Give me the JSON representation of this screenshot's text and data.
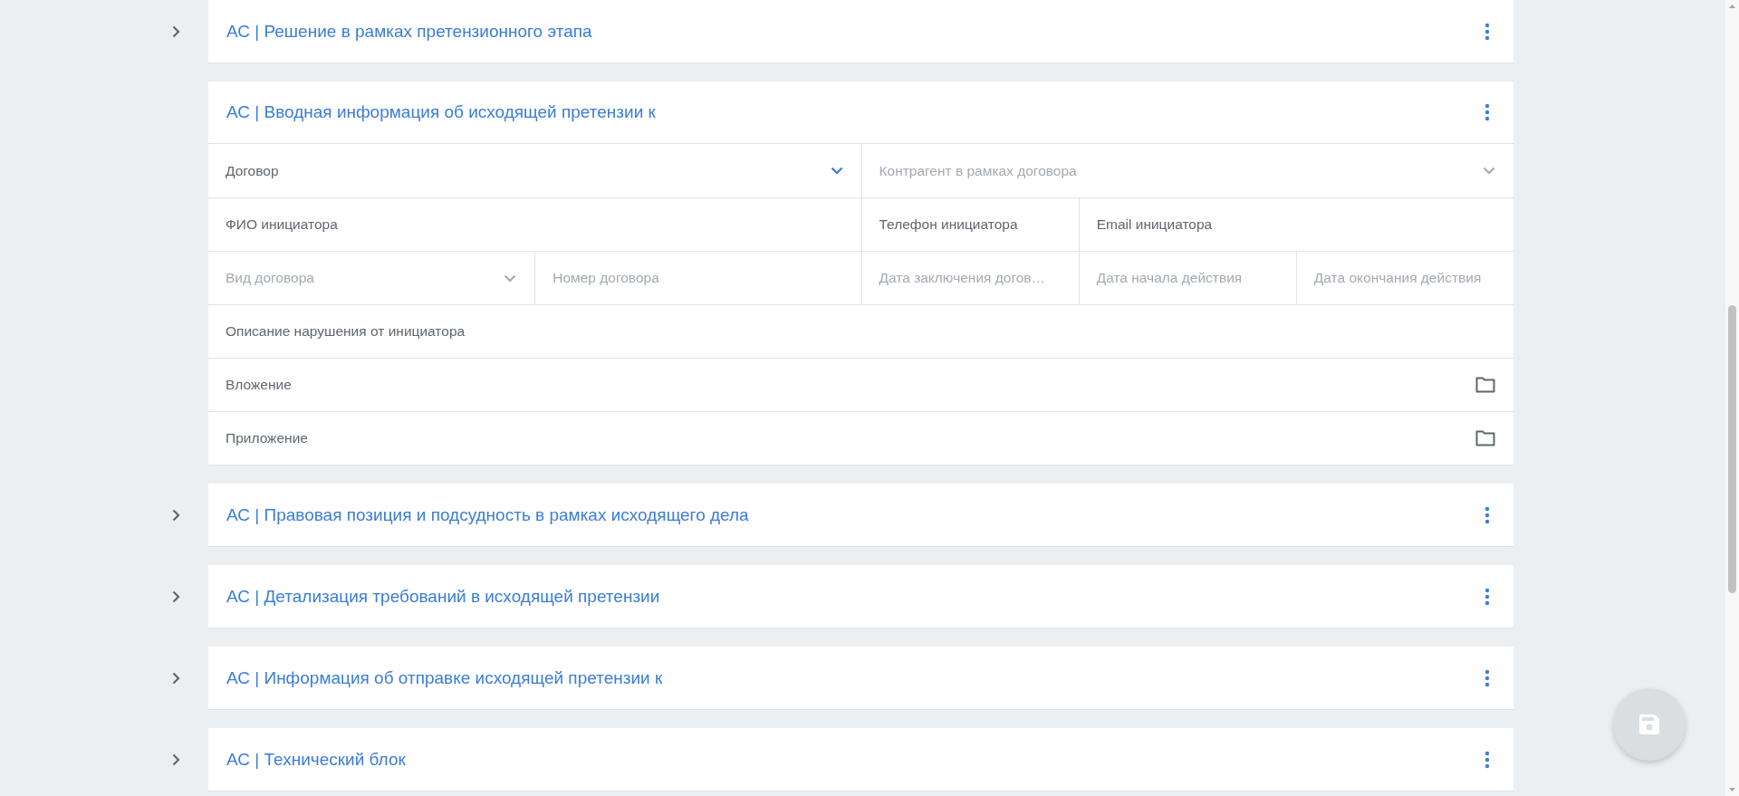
{
  "sections": [
    {
      "title": "АС | Решение в рамках претензионного этапа",
      "expanded": false
    },
    {
      "title": "АС | Вводная информация об исходящей претензии к",
      "expanded": true,
      "fields": [
        {
          "kind": "select",
          "text": "Договор",
          "dimmed": false
        },
        {
          "kind": "select",
          "text": "Контрагент в рамках договора",
          "dimmed": true
        },
        {
          "kind": "text",
          "text": "ФИО инициатора",
          "dimmed": false
        },
        {
          "kind": "text",
          "text": "Телефон инициатора",
          "dimmed": false
        },
        {
          "kind": "text",
          "text": "Email инициатора",
          "dimmed": false
        },
        {
          "kind": "select",
          "text": "Вид договора",
          "dimmed": true
        },
        {
          "kind": "text",
          "text": "Номер договора",
          "dimmed": true
        },
        {
          "kind": "text",
          "text": "Дата заключения догов…",
          "dimmed": true
        },
        {
          "kind": "text",
          "text": "Дата начала действия",
          "dimmed": true
        },
        {
          "kind": "text",
          "text": "Дата окончания действия",
          "dimmed": true
        },
        {
          "kind": "text",
          "text": "Описание нарушения от инициатора",
          "dimmed": false
        },
        {
          "kind": "file",
          "text": "Вложение",
          "dimmed": false
        },
        {
          "kind": "file",
          "text": "Приложение",
          "dimmed": false
        }
      ]
    },
    {
      "title": "АС | Правовая позиция и подсудность в рамках исходящего дела",
      "expanded": false
    },
    {
      "title": "АС | Детализация требований в исходящей претензии",
      "expanded": false
    },
    {
      "title": "АС | Информация об отправке исходящей претензии к",
      "expanded": false
    },
    {
      "title": "АС | Технический блок",
      "expanded": false
    }
  ],
  "save_button": {
    "disabled": true
  }
}
